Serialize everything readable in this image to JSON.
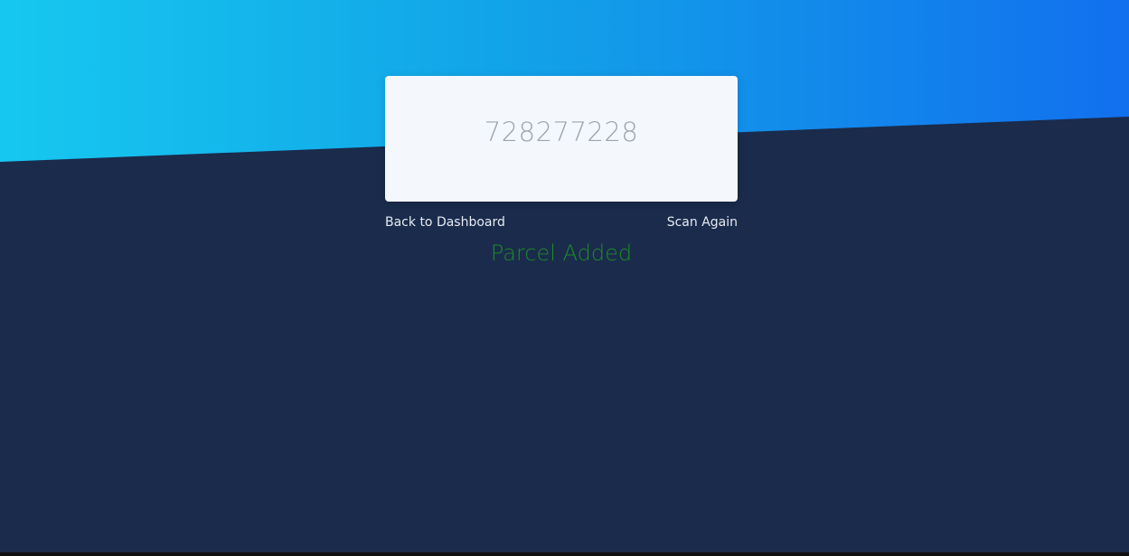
{
  "scanner": {
    "parcel_number": "728277228"
  },
  "nav": {
    "back_label": "Back to Dashboard",
    "scan_again_label": "Scan Again"
  },
  "status": {
    "message": "Parcel Added",
    "color": "#1f8a2a"
  },
  "colors": {
    "background": "#1a2b4c",
    "gradient_start": "#16c8ef",
    "gradient_end": "#1270ee",
    "card": "#f4f8fc"
  }
}
